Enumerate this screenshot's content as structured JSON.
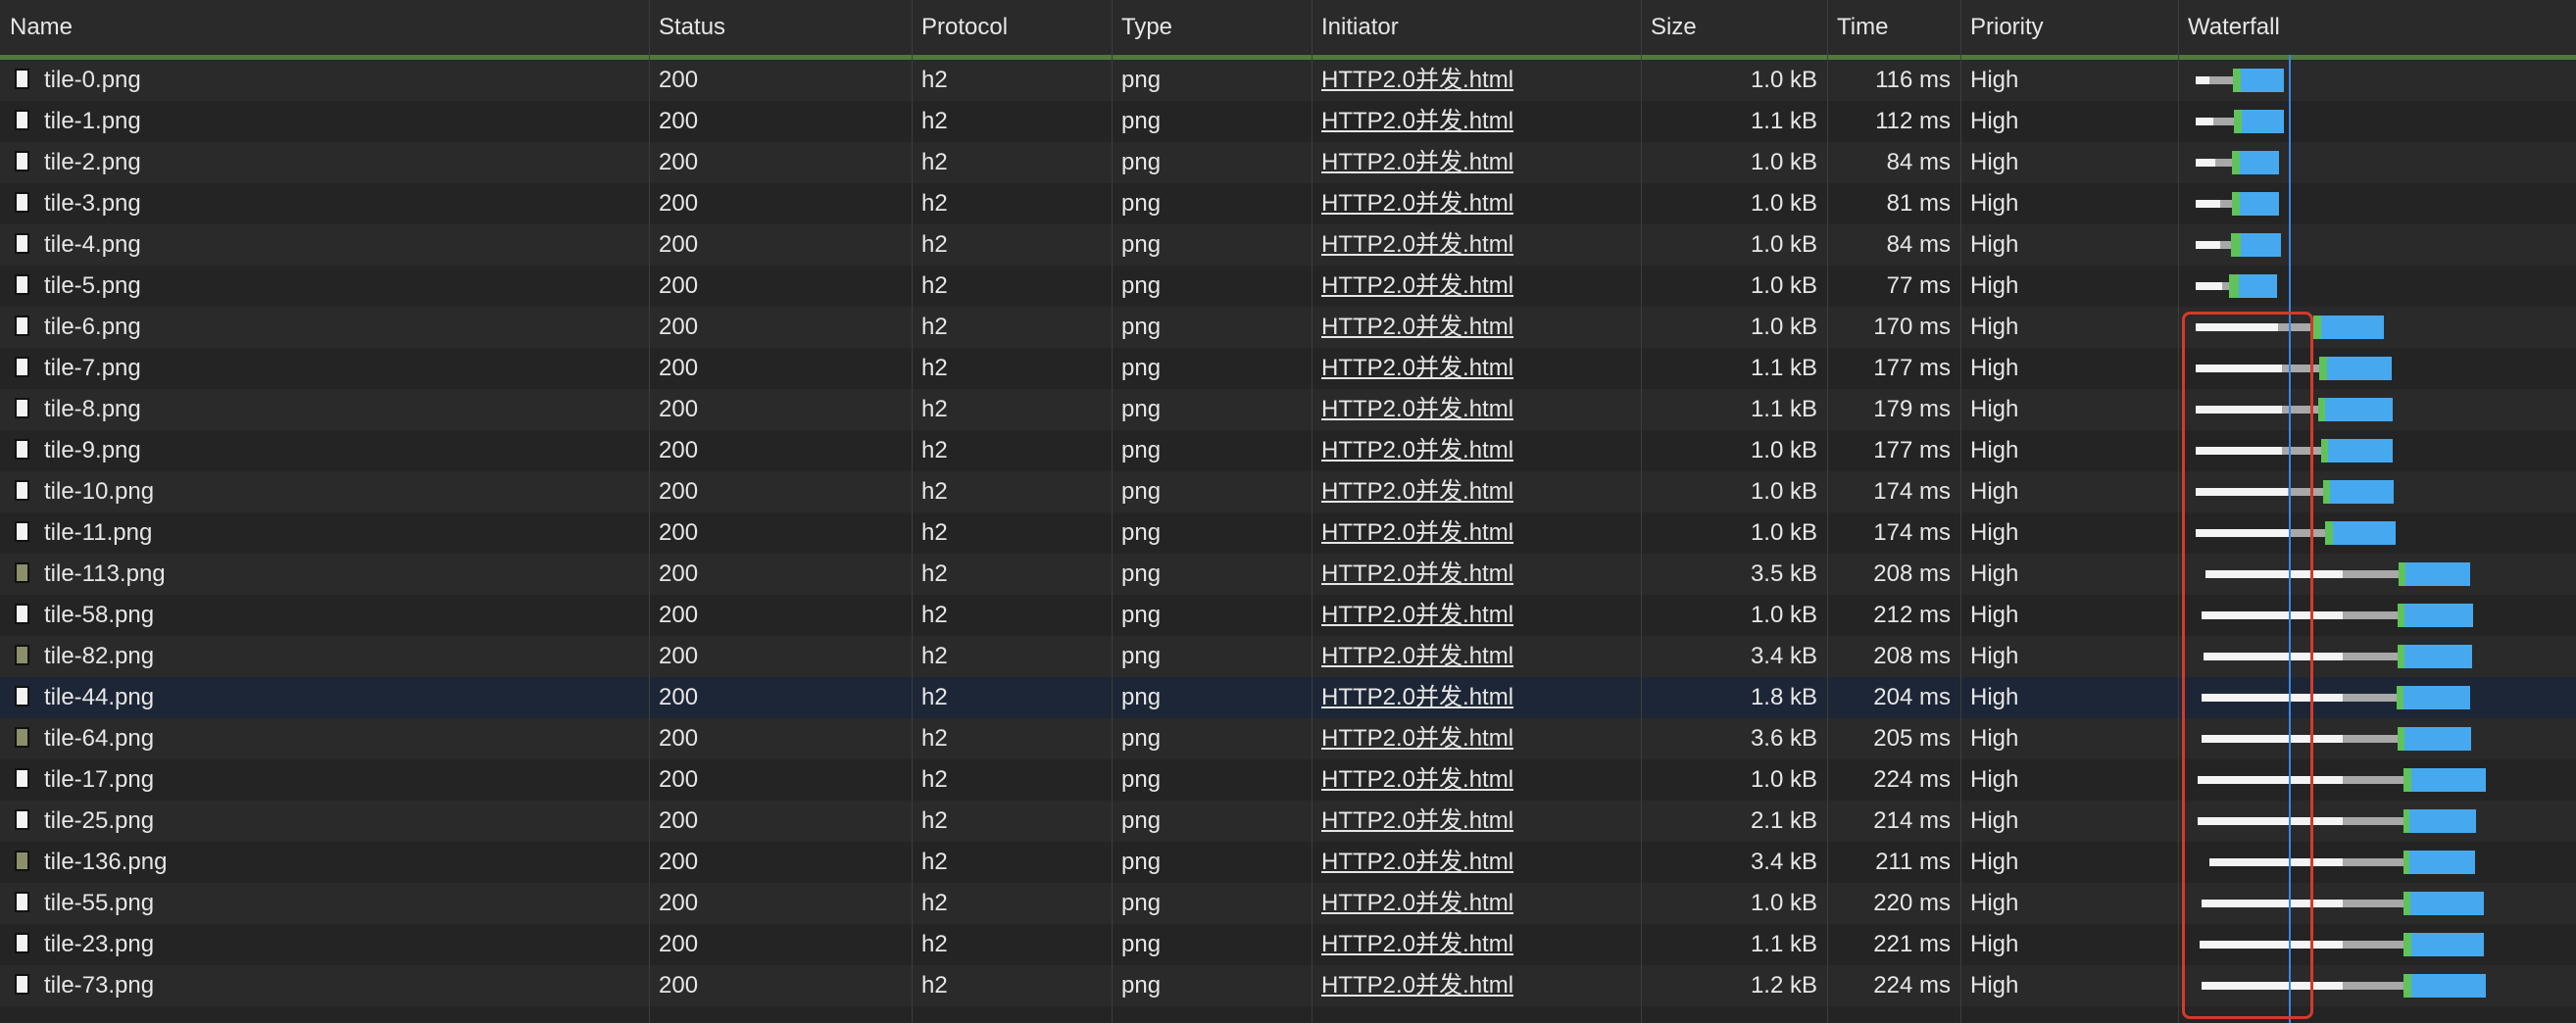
{
  "columns": {
    "name": "Name",
    "status": "Status",
    "protocol": "Protocol",
    "type": "Type",
    "initiator": "Initiator",
    "size": "Size",
    "time": "Time",
    "priority": "Priority",
    "waterfall": "Waterfall"
  },
  "colors": {
    "queue": "#f4f4f4",
    "stalled": "#a8a8a8",
    "ttfb": "#5fc35a",
    "download": "#46a9ef",
    "marker": "#3a86e6",
    "highlight": "#d43a2a"
  },
  "rows": [
    {
      "name": "tile-0.png",
      "status": "200",
      "protocol": "h2",
      "type": "png",
      "initiator": "HTTP2.0并发.html",
      "size": "1.0 kB",
      "time": "116 ms",
      "priority": "High",
      "icon": "page-icon"
    },
    {
      "name": "tile-1.png",
      "status": "200",
      "protocol": "h2",
      "type": "png",
      "initiator": "HTTP2.0并发.html",
      "size": "1.1 kB",
      "time": "112 ms",
      "priority": "High",
      "icon": "page-icon"
    },
    {
      "name": "tile-2.png",
      "status": "200",
      "protocol": "h2",
      "type": "png",
      "initiator": "HTTP2.0并发.html",
      "size": "1.0 kB",
      "time": "84 ms",
      "priority": "High",
      "icon": "page-icon"
    },
    {
      "name": "tile-3.png",
      "status": "200",
      "protocol": "h2",
      "type": "png",
      "initiator": "HTTP2.0并发.html",
      "size": "1.0 kB",
      "time": "81 ms",
      "priority": "High",
      "icon": "page-icon"
    },
    {
      "name": "tile-4.png",
      "status": "200",
      "protocol": "h2",
      "type": "png",
      "initiator": "HTTP2.0并发.html",
      "size": "1.0 kB",
      "time": "84 ms",
      "priority": "High",
      "icon": "page-icon"
    },
    {
      "name": "tile-5.png",
      "status": "200",
      "protocol": "h2",
      "type": "png",
      "initiator": "HTTP2.0并发.html",
      "size": "1.0 kB",
      "time": "77 ms",
      "priority": "High",
      "icon": "page-icon"
    },
    {
      "name": "tile-6.png",
      "status": "200",
      "protocol": "h2",
      "type": "png",
      "initiator": "HTTP2.0并发.html",
      "size": "1.0 kB",
      "time": "170 ms",
      "priority": "High",
      "icon": "page-icon"
    },
    {
      "name": "tile-7.png",
      "status": "200",
      "protocol": "h2",
      "type": "png",
      "initiator": "HTTP2.0并发.html",
      "size": "1.1 kB",
      "time": "177 ms",
      "priority": "High",
      "icon": "page-icon"
    },
    {
      "name": "tile-8.png",
      "status": "200",
      "protocol": "h2",
      "type": "png",
      "initiator": "HTTP2.0并发.html",
      "size": "1.1 kB",
      "time": "179 ms",
      "priority": "High",
      "icon": "page-icon"
    },
    {
      "name": "tile-9.png",
      "status": "200",
      "protocol": "h2",
      "type": "png",
      "initiator": "HTTP2.0并发.html",
      "size": "1.0 kB",
      "time": "177 ms",
      "priority": "High",
      "icon": "page-icon"
    },
    {
      "name": "tile-10.png",
      "status": "200",
      "protocol": "h2",
      "type": "png",
      "initiator": "HTTP2.0并发.html",
      "size": "1.0 kB",
      "time": "174 ms",
      "priority": "High",
      "icon": "page-icon"
    },
    {
      "name": "tile-11.png",
      "status": "200",
      "protocol": "h2",
      "type": "png",
      "initiator": "HTTP2.0并发.html",
      "size": "1.0 kB",
      "time": "174 ms",
      "priority": "High",
      "icon": "page-icon"
    },
    {
      "name": "tile-113.png",
      "status": "200",
      "protocol": "h2",
      "type": "png",
      "initiator": "HTTP2.0并发.html",
      "size": "3.5 kB",
      "time": "208 ms",
      "priority": "High",
      "icon": "image-icon"
    },
    {
      "name": "tile-58.png",
      "status": "200",
      "protocol": "h2",
      "type": "png",
      "initiator": "HTTP2.0并发.html",
      "size": "1.0 kB",
      "time": "212 ms",
      "priority": "High",
      "icon": "page-icon"
    },
    {
      "name": "tile-82.png",
      "status": "200",
      "protocol": "h2",
      "type": "png",
      "initiator": "HTTP2.0并发.html",
      "size": "3.4 kB",
      "time": "208 ms",
      "priority": "High",
      "icon": "image-icon"
    },
    {
      "name": "tile-44.png",
      "status": "200",
      "protocol": "h2",
      "type": "png",
      "initiator": "HTTP2.0并发.html",
      "size": "1.8 kB",
      "time": "204 ms",
      "priority": "High",
      "icon": "page-icon"
    },
    {
      "name": "tile-64.png",
      "status": "200",
      "protocol": "h2",
      "type": "png",
      "initiator": "HTTP2.0并发.html",
      "size": "3.6 kB",
      "time": "205 ms",
      "priority": "High",
      "icon": "image-icon"
    },
    {
      "name": "tile-17.png",
      "status": "200",
      "protocol": "h2",
      "type": "png",
      "initiator": "HTTP2.0并发.html",
      "size": "1.0 kB",
      "time": "224 ms",
      "priority": "High",
      "icon": "page-icon"
    },
    {
      "name": "tile-25.png",
      "status": "200",
      "protocol": "h2",
      "type": "png",
      "initiator": "HTTP2.0并发.html",
      "size": "2.1 kB",
      "time": "214 ms",
      "priority": "High",
      "icon": "page-icon"
    },
    {
      "name": "tile-136.png",
      "status": "200",
      "protocol": "h2",
      "type": "png",
      "initiator": "HTTP2.0并发.html",
      "size": "3.4 kB",
      "time": "211 ms",
      "priority": "High",
      "icon": "image-icon"
    },
    {
      "name": "tile-55.png",
      "status": "200",
      "protocol": "h2",
      "type": "png",
      "initiator": "HTTP2.0并发.html",
      "size": "1.0 kB",
      "time": "220 ms",
      "priority": "High",
      "icon": "page-icon"
    },
    {
      "name": "tile-23.png",
      "status": "200",
      "protocol": "h2",
      "type": "png",
      "initiator": "HTTP2.0并发.html",
      "size": "1.1 kB",
      "time": "221 ms",
      "priority": "High",
      "icon": "page-icon"
    },
    {
      "name": "tile-73.png",
      "status": "200",
      "protocol": "h2",
      "type": "png",
      "initiator": "HTTP2.0并发.html",
      "size": "1.2 kB",
      "time": "224 ms",
      "priority": "High",
      "icon": "page-icon"
    }
  ]
}
